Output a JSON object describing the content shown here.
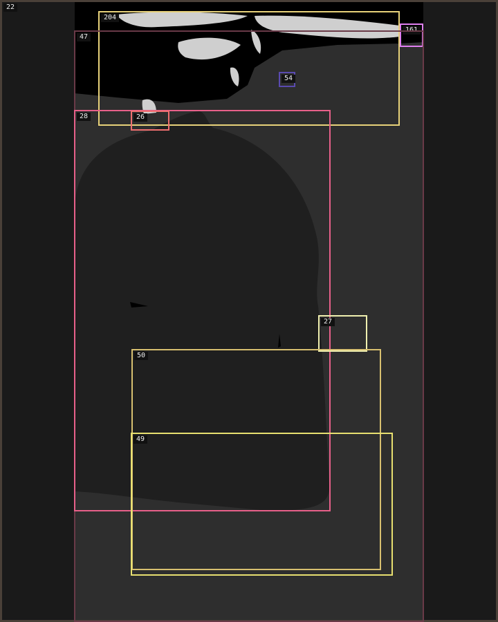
{
  "overlay": {
    "labels": {
      "l22": "22",
      "l204": "204",
      "l161": "161",
      "l47": "47",
      "l54": "54",
      "l28": "28",
      "l26": "26",
      "l27": "27",
      "l50": "50",
      "l49": "49"
    }
  },
  "colors": {
    "frame": "#4a4038",
    "panel_bg": "#2e2e2e",
    "silhouette": "#1f1f1f",
    "top_region": "#000000",
    "highlight": "#cfcfcf",
    "box22": "#4a4038",
    "box204": "#e8d27a",
    "box161": "#e080f0",
    "box47": "#6a3a48",
    "box54": "#5a4ab0",
    "box28": "#e8608a",
    "box26": "#f07070",
    "box27": "#f0f0b0",
    "box50": "#d8c070",
    "box49": "#e8e070"
  }
}
